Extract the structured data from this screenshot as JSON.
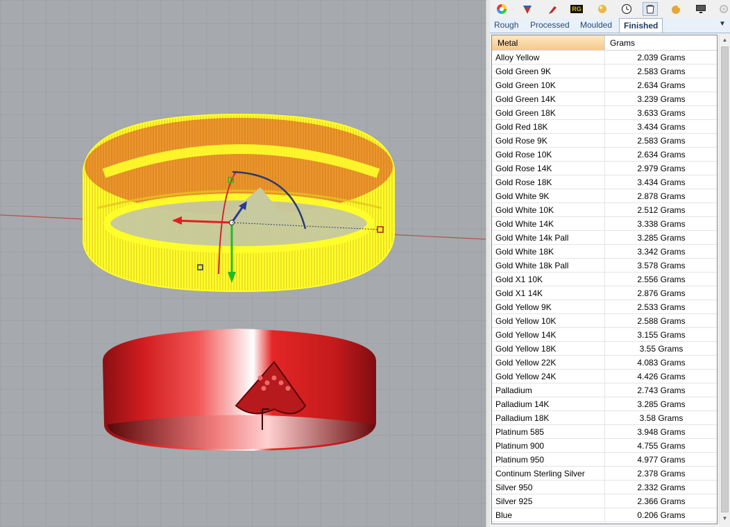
{
  "toolbar": {
    "icons": [
      "color-wheel-icon",
      "material-icon",
      "pen-tool-icon",
      "rg-logo-icon",
      "gem-icon",
      "clock-icon",
      "bucket-icon",
      "sphere-light-icon",
      "monitor-icon",
      "settings-icon"
    ],
    "rg_text": "RG"
  },
  "tabs": [
    {
      "label": "Rough"
    },
    {
      "label": "Processed"
    },
    {
      "label": "Moulded"
    },
    {
      "label": "Finished"
    }
  ],
  "active_tab": "Finished",
  "table": {
    "headers": {
      "metal": "Metal",
      "grams": "Grams"
    },
    "rows": [
      {
        "metal": "Alloy Yellow",
        "grams": "2.039 Grams"
      },
      {
        "metal": "Gold Green 9K",
        "grams": "2.583 Grams"
      },
      {
        "metal": "Gold Green 10K",
        "grams": "2.634 Grams"
      },
      {
        "metal": "Gold Green 14K",
        "grams": "3.239 Grams"
      },
      {
        "metal": "Gold Green 18K",
        "grams": "3.633 Grams"
      },
      {
        "metal": "Gold Red 18K",
        "grams": "3.434 Grams"
      },
      {
        "metal": "Gold Rose 9K",
        "grams": "2.583 Grams"
      },
      {
        "metal": "Gold Rose 10K",
        "grams": "2.634 Grams"
      },
      {
        "metal": "Gold Rose 14K",
        "grams": "2.979 Grams"
      },
      {
        "metal": "Gold Rose 18K",
        "grams": "3.434 Grams"
      },
      {
        "metal": "Gold White 9K",
        "grams": "2.878 Grams"
      },
      {
        "metal": "Gold White 10K",
        "grams": "2.512 Grams"
      },
      {
        "metal": "Gold White 14K",
        "grams": "3.338 Grams"
      },
      {
        "metal": "Gold White 14k Pall",
        "grams": "3.285 Grams"
      },
      {
        "metal": "Gold White 18K",
        "grams": "3.342 Grams"
      },
      {
        "metal": "Gold White 18k Pall",
        "grams": "3.578 Grams"
      },
      {
        "metal": "Gold X1 10K",
        "grams": "2.556 Grams"
      },
      {
        "metal": "Gold X1 14K",
        "grams": "2.876 Grams"
      },
      {
        "metal": "Gold Yellow 9K",
        "grams": "2.533 Grams"
      },
      {
        "metal": "Gold Yellow 10K",
        "grams": "2.588 Grams"
      },
      {
        "metal": "Gold Yellow 14K",
        "grams": "3.155 Grams"
      },
      {
        "metal": "Gold Yellow 18K",
        "grams": "3.55 Grams"
      },
      {
        "metal": "Gold Yellow 22K",
        "grams": "4.083 Grams"
      },
      {
        "metal": "Gold Yellow 24K",
        "grams": "4.426 Grams"
      },
      {
        "metal": "Palladium",
        "grams": "2.743 Grams"
      },
      {
        "metal": "Palladium 14K",
        "grams": "3.285 Grams"
      },
      {
        "metal": "Palladium 18K",
        "grams": "3.58 Grams"
      },
      {
        "metal": "Platinum 585",
        "grams": "3.948 Grams"
      },
      {
        "metal": "Platinum 900",
        "grams": "4.755 Grams"
      },
      {
        "metal": "Platinum 950",
        "grams": "4.977 Grams"
      },
      {
        "metal": "Continum Sterling Silver",
        "grams": "2.378 Grams"
      },
      {
        "metal": "Silver 950",
        "grams": "2.332 Grams"
      },
      {
        "metal": "Silver 925",
        "grams": "2.366 Grams"
      },
      {
        "metal": "Blue",
        "grams": "0.206 Grams"
      }
    ]
  },
  "colors": {
    "viewport_bg": "#a6a9ad",
    "wireframe": "#ffff2a",
    "ring_red": "#d81e1e",
    "header_active": "#f6c98a"
  }
}
